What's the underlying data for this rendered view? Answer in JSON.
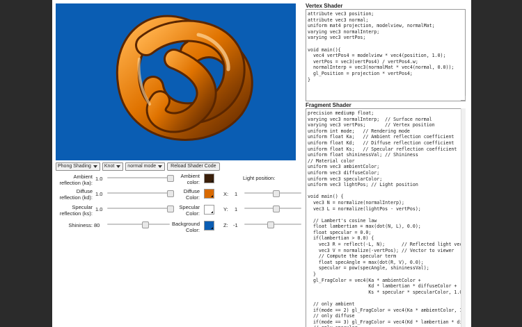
{
  "controls": {
    "shading": "Phong Shading",
    "model": "Knot",
    "mode": "normal mode",
    "reload_label": "Reload Shader Code"
  },
  "params": {
    "ambient": {
      "label": "Ambient reflection (ka):",
      "value": "1.0",
      "level": 1.0
    },
    "diffuse": {
      "label": "Diffuse reflection (kd):",
      "value": "1.0",
      "level": 1.0
    },
    "specular": {
      "label": "Specular reflection (ks):",
      "value": "1.0",
      "level": 1.0
    },
    "shininess": {
      "label": "Shininess:",
      "value": "80",
      "level": 0.6
    }
  },
  "colors": {
    "ambient": {
      "label": "Ambient color:",
      "hex": "#3a1f0a"
    },
    "diffuse": {
      "label": "Diffuse Color:",
      "hex": "#d96a00"
    },
    "specular": {
      "label": "Specular Color:",
      "hex": "#ffffff"
    },
    "background": {
      "label": "Background Color:",
      "hex": "#0a5db3"
    }
  },
  "light": {
    "title": "Light position:",
    "x": {
      "label": "X:",
      "value": "1"
    },
    "y": {
      "label": "Y:",
      "value": "1"
    },
    "z": {
      "label": "Z:",
      "value": "-1"
    }
  },
  "vertex": {
    "title": "Vertex Shader",
    "code": "attribute vec3 position;\nattribute vec3 normal;\nuniform mat4 projection, modelview, normalMat;\nvarying vec3 normalInterp;\nvarying vec3 vertPos;\n\nvoid main(){\n  vec4 vertPos4 = modelview * vec4(position, 1.0);\n  vertPos = vec3(vertPos4) / vertPos4.w;\n  normalInterp = vec3(normalMat * vec4(normal, 0.0));\n  gl_Position = projection * vertPos4;\n}"
  },
  "fragment": {
    "title": "Fragment Shader",
    "code": "precision mediump float;\nvarying vec3 normalInterp;  // Surface normal\nvarying vec3 vertPos;       // Vertex position\nuniform int mode;   // Rendering mode\nuniform float Ka;   // Ambient reflection coefficient\nuniform float Kd;   // Diffuse reflection coefficient\nuniform float Ks;   // Specular reflection coefficient\nuniform float shininessVal; // Shininess\n// Material color\nuniform vec3 ambientColor;\nuniform vec3 diffuseColor;\nuniform vec3 specularColor;\nuniform vec3 lightPos; // Light position\n\nvoid main() {\n  vec3 N = normalize(normalInterp);\n  vec3 L = normalize(lightPos - vertPos);\n\n  // Lambert's cosine law\n  float lambertian = max(dot(N, L), 0.0);\n  float specular = 0.0;\n  if(lambertian > 0.0) {\n    vec3 R = reflect(-L, N);      // Reflected light vector\n    vec3 V = normalize(-vertPos); // Vector to viewer\n    // Compute the specular term\n    float specAngle = max(dot(R, V), 0.0);\n    specular = pow(specAngle, shininessVal);\n  }\n  gl_FragColor = vec4(Ka * ambientColor +\n                      Kd * lambertian * diffuseColor +\n                      Ks * specular * specularColor, 1.0);\n\n  // only ambient\n  if(mode == 2) gl_FragColor = vec4(Ka * ambientColor, 1.0);\n  // only diffuse\n  if(mode == 3) gl_FragColor = vec4(Kd * lambertian * diffuseColor, 1.0);\n  // only specular"
  }
}
